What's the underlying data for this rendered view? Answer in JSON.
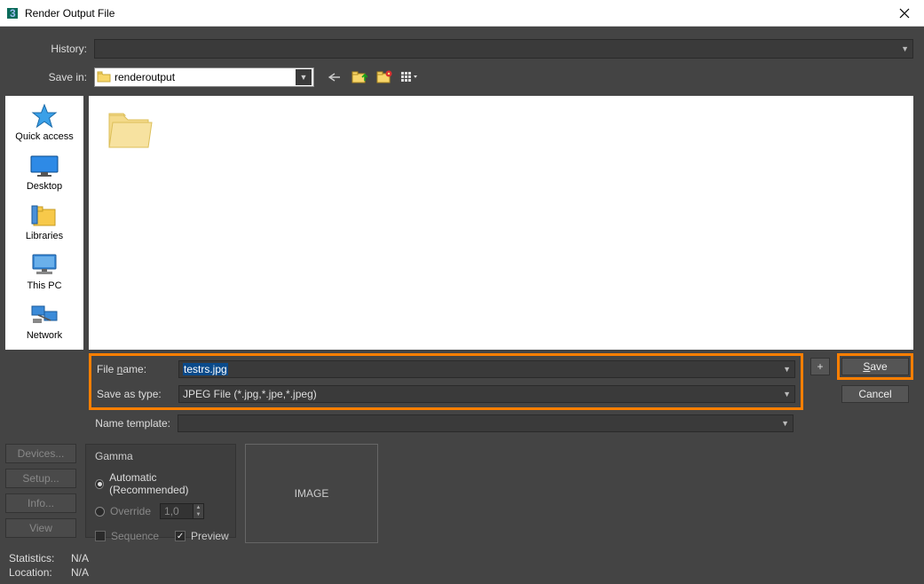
{
  "window": {
    "title": "Render Output File"
  },
  "labels": {
    "history": "History:",
    "savein": "Save in:",
    "filename": "File name:",
    "saveastype": "Save as type:",
    "nametemplate": "Name template:",
    "gamma": "Gamma",
    "automatic": "Automatic (Recommended)",
    "override": "Override",
    "sequence": "Sequence",
    "preview": "Preview",
    "image": "IMAGE",
    "statistics": "Statistics:",
    "location": "Location:"
  },
  "savein_value": "renderoutput",
  "places": {
    "quickaccess": "Quick access",
    "desktop": "Desktop",
    "libraries": "Libraries",
    "thispc": "This PC",
    "network": "Network"
  },
  "filename_value": "testrs.jpg",
  "saveastype_value": "JPEG File (*.jpg,*.jpe,*.jpeg)",
  "override_value": "1,0",
  "buttons": {
    "plus": "+",
    "save": "Save",
    "cancel": "Cancel",
    "devices": "Devices...",
    "setup": "Setup...",
    "info": "Info...",
    "view": "View"
  },
  "stats": {
    "statistics": "N/A",
    "location": "N/A"
  },
  "gamma": {
    "automatic_selected": true,
    "preview_checked": true,
    "sequence_checked": false
  }
}
